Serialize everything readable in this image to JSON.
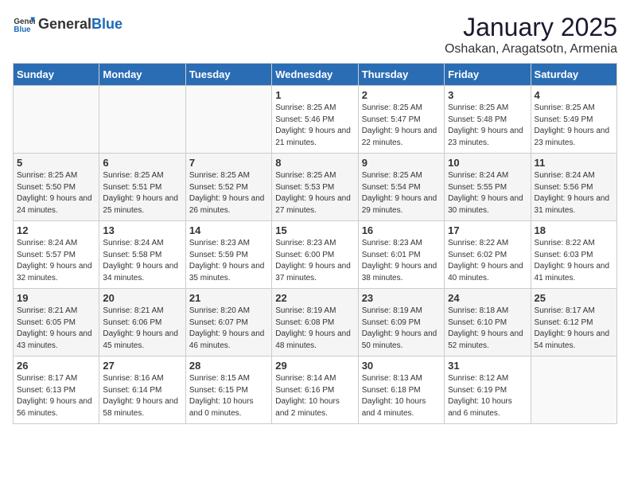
{
  "header": {
    "logo_general": "General",
    "logo_blue": "Blue",
    "title": "January 2025",
    "subtitle": "Oshakan, Aragatsotn, Armenia"
  },
  "weekdays": [
    "Sunday",
    "Monday",
    "Tuesday",
    "Wednesday",
    "Thursday",
    "Friday",
    "Saturday"
  ],
  "weeks": [
    [
      {
        "day": "",
        "sunrise": "",
        "sunset": "",
        "daylight": ""
      },
      {
        "day": "",
        "sunrise": "",
        "sunset": "",
        "daylight": ""
      },
      {
        "day": "",
        "sunrise": "",
        "sunset": "",
        "daylight": ""
      },
      {
        "day": "1",
        "sunrise": "Sunrise: 8:25 AM",
        "sunset": "Sunset: 5:46 PM",
        "daylight": "Daylight: 9 hours and 21 minutes."
      },
      {
        "day": "2",
        "sunrise": "Sunrise: 8:25 AM",
        "sunset": "Sunset: 5:47 PM",
        "daylight": "Daylight: 9 hours and 22 minutes."
      },
      {
        "day": "3",
        "sunrise": "Sunrise: 8:25 AM",
        "sunset": "Sunset: 5:48 PM",
        "daylight": "Daylight: 9 hours and 23 minutes."
      },
      {
        "day": "4",
        "sunrise": "Sunrise: 8:25 AM",
        "sunset": "Sunset: 5:49 PM",
        "daylight": "Daylight: 9 hours and 23 minutes."
      }
    ],
    [
      {
        "day": "5",
        "sunrise": "Sunrise: 8:25 AM",
        "sunset": "Sunset: 5:50 PM",
        "daylight": "Daylight: 9 hours and 24 minutes."
      },
      {
        "day": "6",
        "sunrise": "Sunrise: 8:25 AM",
        "sunset": "Sunset: 5:51 PM",
        "daylight": "Daylight: 9 hours and 25 minutes."
      },
      {
        "day": "7",
        "sunrise": "Sunrise: 8:25 AM",
        "sunset": "Sunset: 5:52 PM",
        "daylight": "Daylight: 9 hours and 26 minutes."
      },
      {
        "day": "8",
        "sunrise": "Sunrise: 8:25 AM",
        "sunset": "Sunset: 5:53 PM",
        "daylight": "Daylight: 9 hours and 27 minutes."
      },
      {
        "day": "9",
        "sunrise": "Sunrise: 8:25 AM",
        "sunset": "Sunset: 5:54 PM",
        "daylight": "Daylight: 9 hours and 29 minutes."
      },
      {
        "day": "10",
        "sunrise": "Sunrise: 8:24 AM",
        "sunset": "Sunset: 5:55 PM",
        "daylight": "Daylight: 9 hours and 30 minutes."
      },
      {
        "day": "11",
        "sunrise": "Sunrise: 8:24 AM",
        "sunset": "Sunset: 5:56 PM",
        "daylight": "Daylight: 9 hours and 31 minutes."
      }
    ],
    [
      {
        "day": "12",
        "sunrise": "Sunrise: 8:24 AM",
        "sunset": "Sunset: 5:57 PM",
        "daylight": "Daylight: 9 hours and 32 minutes."
      },
      {
        "day": "13",
        "sunrise": "Sunrise: 8:24 AM",
        "sunset": "Sunset: 5:58 PM",
        "daylight": "Daylight: 9 hours and 34 minutes."
      },
      {
        "day": "14",
        "sunrise": "Sunrise: 8:23 AM",
        "sunset": "Sunset: 5:59 PM",
        "daylight": "Daylight: 9 hours and 35 minutes."
      },
      {
        "day": "15",
        "sunrise": "Sunrise: 8:23 AM",
        "sunset": "Sunset: 6:00 PM",
        "daylight": "Daylight: 9 hours and 37 minutes."
      },
      {
        "day": "16",
        "sunrise": "Sunrise: 8:23 AM",
        "sunset": "Sunset: 6:01 PM",
        "daylight": "Daylight: 9 hours and 38 minutes."
      },
      {
        "day": "17",
        "sunrise": "Sunrise: 8:22 AM",
        "sunset": "Sunset: 6:02 PM",
        "daylight": "Daylight: 9 hours and 40 minutes."
      },
      {
        "day": "18",
        "sunrise": "Sunrise: 8:22 AM",
        "sunset": "Sunset: 6:03 PM",
        "daylight": "Daylight: 9 hours and 41 minutes."
      }
    ],
    [
      {
        "day": "19",
        "sunrise": "Sunrise: 8:21 AM",
        "sunset": "Sunset: 6:05 PM",
        "daylight": "Daylight: 9 hours and 43 minutes."
      },
      {
        "day": "20",
        "sunrise": "Sunrise: 8:21 AM",
        "sunset": "Sunset: 6:06 PM",
        "daylight": "Daylight: 9 hours and 45 minutes."
      },
      {
        "day": "21",
        "sunrise": "Sunrise: 8:20 AM",
        "sunset": "Sunset: 6:07 PM",
        "daylight": "Daylight: 9 hours and 46 minutes."
      },
      {
        "day": "22",
        "sunrise": "Sunrise: 8:19 AM",
        "sunset": "Sunset: 6:08 PM",
        "daylight": "Daylight: 9 hours and 48 minutes."
      },
      {
        "day": "23",
        "sunrise": "Sunrise: 8:19 AM",
        "sunset": "Sunset: 6:09 PM",
        "daylight": "Daylight: 9 hours and 50 minutes."
      },
      {
        "day": "24",
        "sunrise": "Sunrise: 8:18 AM",
        "sunset": "Sunset: 6:10 PM",
        "daylight": "Daylight: 9 hours and 52 minutes."
      },
      {
        "day": "25",
        "sunrise": "Sunrise: 8:17 AM",
        "sunset": "Sunset: 6:12 PM",
        "daylight": "Daylight: 9 hours and 54 minutes."
      }
    ],
    [
      {
        "day": "26",
        "sunrise": "Sunrise: 8:17 AM",
        "sunset": "Sunset: 6:13 PM",
        "daylight": "Daylight: 9 hours and 56 minutes."
      },
      {
        "day": "27",
        "sunrise": "Sunrise: 8:16 AM",
        "sunset": "Sunset: 6:14 PM",
        "daylight": "Daylight: 9 hours and 58 minutes."
      },
      {
        "day": "28",
        "sunrise": "Sunrise: 8:15 AM",
        "sunset": "Sunset: 6:15 PM",
        "daylight": "Daylight: 10 hours and 0 minutes."
      },
      {
        "day": "29",
        "sunrise": "Sunrise: 8:14 AM",
        "sunset": "Sunset: 6:16 PM",
        "daylight": "Daylight: 10 hours and 2 minutes."
      },
      {
        "day": "30",
        "sunrise": "Sunrise: 8:13 AM",
        "sunset": "Sunset: 6:18 PM",
        "daylight": "Daylight: 10 hours and 4 minutes."
      },
      {
        "day": "31",
        "sunrise": "Sunrise: 8:12 AM",
        "sunset": "Sunset: 6:19 PM",
        "daylight": "Daylight: 10 hours and 6 minutes."
      },
      {
        "day": "",
        "sunrise": "",
        "sunset": "",
        "daylight": ""
      }
    ]
  ]
}
